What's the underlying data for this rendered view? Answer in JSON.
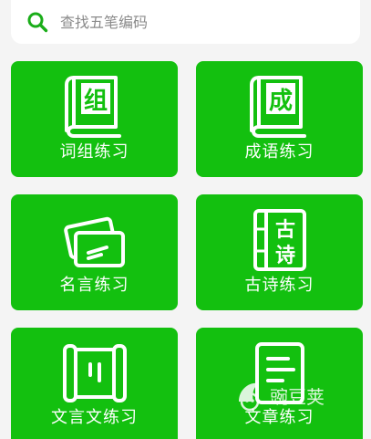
{
  "search": {
    "placeholder": "查找五笔编码",
    "icon": "search-icon",
    "accent_color": "#1aad19"
  },
  "colors": {
    "card_bg": "#13c00f",
    "page_bg": "#f4f4f4"
  },
  "cards": [
    {
      "label": "词组练习",
      "icon": "book-icon",
      "glyph": "组"
    },
    {
      "label": "成语练习",
      "icon": "book-icon",
      "glyph": "成"
    },
    {
      "label": "名言练习",
      "icon": "cards-icon"
    },
    {
      "label": "古诗练习",
      "icon": "poem-book-icon",
      "glyph1": "古",
      "glyph2": "诗"
    },
    {
      "label": "文言文练习",
      "icon": "scroll-icon"
    },
    {
      "label": "文章练习",
      "icon": "document-icon"
    }
  ],
  "watermark": {
    "text": "豌豆荚",
    "icon": "wandoujia-logo"
  }
}
